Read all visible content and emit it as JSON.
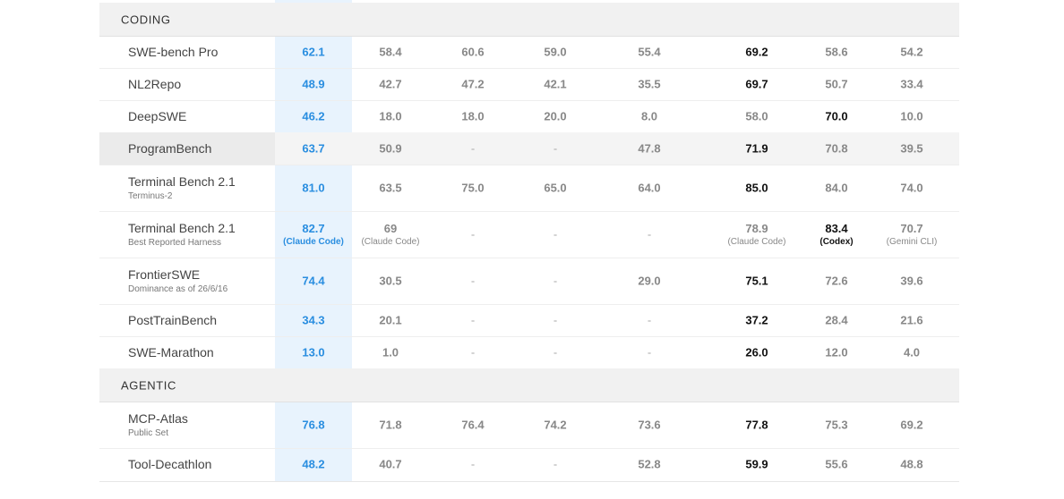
{
  "sections": [
    {
      "label": "CODING",
      "rows": [
        {
          "name": "SWE-bench Pro",
          "sub": "",
          "cells": [
            {
              "v": "62.1",
              "n": "",
              "k": "ours"
            },
            {
              "v": "58.4",
              "n": "",
              "k": ""
            },
            {
              "v": "60.6",
              "n": "",
              "k": ""
            },
            {
              "v": "59.0",
              "n": "",
              "k": ""
            },
            {
              "v": "55.4",
              "n": "",
              "k": ""
            },
            {
              "v": "69.2",
              "n": "",
              "k": "best"
            },
            {
              "v": "58.6",
              "n": "",
              "k": ""
            },
            {
              "v": "54.2",
              "n": "",
              "k": ""
            }
          ]
        },
        {
          "name": "NL2Repo",
          "sub": "",
          "cells": [
            {
              "v": "48.9",
              "n": "",
              "k": "ours"
            },
            {
              "v": "42.7",
              "n": "",
              "k": ""
            },
            {
              "v": "47.2",
              "n": "",
              "k": ""
            },
            {
              "v": "42.1",
              "n": "",
              "k": ""
            },
            {
              "v": "35.5",
              "n": "",
              "k": ""
            },
            {
              "v": "69.7",
              "n": "",
              "k": "best"
            },
            {
              "v": "50.7",
              "n": "",
              "k": ""
            },
            {
              "v": "33.4",
              "n": "",
              "k": ""
            }
          ]
        },
        {
          "name": "DeepSWE",
          "sub": "",
          "cells": [
            {
              "v": "46.2",
              "n": "",
              "k": "ours"
            },
            {
              "v": "18.0",
              "n": "",
              "k": ""
            },
            {
              "v": "18.0",
              "n": "",
              "k": ""
            },
            {
              "v": "20.0",
              "n": "",
              "k": ""
            },
            {
              "v": "8.0",
              "n": "",
              "k": ""
            },
            {
              "v": "58.0",
              "n": "",
              "k": ""
            },
            {
              "v": "70.0",
              "n": "",
              "k": "best"
            },
            {
              "v": "10.0",
              "n": "",
              "k": ""
            }
          ]
        },
        {
          "name": "ProgramBench",
          "sub": "",
          "hover": true,
          "cells": [
            {
              "v": "63.7",
              "n": "",
              "k": "ours"
            },
            {
              "v": "50.9",
              "n": "",
              "k": ""
            },
            {
              "v": "-",
              "n": "",
              "k": "dash"
            },
            {
              "v": "-",
              "n": "",
              "k": "dash"
            },
            {
              "v": "47.8",
              "n": "",
              "k": ""
            },
            {
              "v": "71.9",
              "n": "",
              "k": "best"
            },
            {
              "v": "70.8",
              "n": "",
              "k": ""
            },
            {
              "v": "39.5",
              "n": "",
              "k": ""
            }
          ]
        },
        {
          "name": "Terminal Bench 2.1",
          "sub": "Terminus-2",
          "cells": [
            {
              "v": "81.0",
              "n": "",
              "k": "ours"
            },
            {
              "v": "63.5",
              "n": "",
              "k": ""
            },
            {
              "v": "75.0",
              "n": "",
              "k": ""
            },
            {
              "v": "65.0",
              "n": "",
              "k": ""
            },
            {
              "v": "64.0",
              "n": "",
              "k": ""
            },
            {
              "v": "85.0",
              "n": "",
              "k": "best"
            },
            {
              "v": "84.0",
              "n": "",
              "k": ""
            },
            {
              "v": "74.0",
              "n": "",
              "k": ""
            }
          ]
        },
        {
          "name": "Terminal Bench 2.1",
          "sub": "Best Reported Harness",
          "cells": [
            {
              "v": "82.7",
              "n": "(Claude Code)",
              "k": "ours"
            },
            {
              "v": "69",
              "n": "(Claude Code)",
              "k": ""
            },
            {
              "v": "-",
              "n": "",
              "k": "dash"
            },
            {
              "v": "-",
              "n": "",
              "k": "dash"
            },
            {
              "v": "-",
              "n": "",
              "k": "dash"
            },
            {
              "v": "78.9",
              "n": "(Claude Code)",
              "k": ""
            },
            {
              "v": "83.4",
              "n": "(Codex)",
              "k": "best"
            },
            {
              "v": "70.7",
              "n": "(Gemini CLI)",
              "k": ""
            }
          ]
        },
        {
          "name": "FrontierSWE",
          "sub": "Dominance as of 26/6/16",
          "cells": [
            {
              "v": "74.4",
              "n": "",
              "k": "ours"
            },
            {
              "v": "30.5",
              "n": "",
              "k": ""
            },
            {
              "v": "-",
              "n": "",
              "k": "dash"
            },
            {
              "v": "-",
              "n": "",
              "k": "dash"
            },
            {
              "v": "29.0",
              "n": "",
              "k": ""
            },
            {
              "v": "75.1",
              "n": "",
              "k": "best"
            },
            {
              "v": "72.6",
              "n": "",
              "k": ""
            },
            {
              "v": "39.6",
              "n": "",
              "k": ""
            }
          ]
        },
        {
          "name": "PostTrainBench",
          "sub": "",
          "cells": [
            {
              "v": "34.3",
              "n": "",
              "k": "ours"
            },
            {
              "v": "20.1",
              "n": "",
              "k": ""
            },
            {
              "v": "-",
              "n": "",
              "k": "dash"
            },
            {
              "v": "-",
              "n": "",
              "k": "dash"
            },
            {
              "v": "-",
              "n": "",
              "k": "dash"
            },
            {
              "v": "37.2",
              "n": "",
              "k": "best"
            },
            {
              "v": "28.4",
              "n": "",
              "k": ""
            },
            {
              "v": "21.6",
              "n": "",
              "k": ""
            }
          ]
        },
        {
          "name": "SWE-Marathon",
          "sub": "",
          "cells": [
            {
              "v": "13.0",
              "n": "",
              "k": "ours"
            },
            {
              "v": "1.0",
              "n": "",
              "k": ""
            },
            {
              "v": "-",
              "n": "",
              "k": "dash"
            },
            {
              "v": "-",
              "n": "",
              "k": "dash"
            },
            {
              "v": "-",
              "n": "",
              "k": "dash"
            },
            {
              "v": "26.0",
              "n": "",
              "k": "best"
            },
            {
              "v": "12.0",
              "n": "",
              "k": ""
            },
            {
              "v": "4.0",
              "n": "",
              "k": ""
            }
          ]
        }
      ]
    },
    {
      "label": "AGENTIC",
      "rows": [
        {
          "name": "MCP-Atlas",
          "sub": "Public Set",
          "cells": [
            {
              "v": "76.8",
              "n": "",
              "k": "ours"
            },
            {
              "v": "71.8",
              "n": "",
              "k": ""
            },
            {
              "v": "76.4",
              "n": "",
              "k": ""
            },
            {
              "v": "74.2",
              "n": "",
              "k": ""
            },
            {
              "v": "73.6",
              "n": "",
              "k": ""
            },
            {
              "v": "77.8",
              "n": "",
              "k": "best"
            },
            {
              "v": "75.3",
              "n": "",
              "k": ""
            },
            {
              "v": "69.2",
              "n": "",
              "k": ""
            }
          ]
        },
        {
          "name": "Tool-Decathlon",
          "sub": "",
          "cells": [
            {
              "v": "48.2",
              "n": "",
              "k": "ours"
            },
            {
              "v": "40.7",
              "n": "",
              "k": ""
            },
            {
              "v": "-",
              "n": "",
              "k": "dash"
            },
            {
              "v": "-",
              "n": "",
              "k": "dash"
            },
            {
              "v": "52.8",
              "n": "",
              "k": ""
            },
            {
              "v": "59.9",
              "n": "",
              "k": "best"
            },
            {
              "v": "55.6",
              "n": "",
              "k": ""
            },
            {
              "v": "48.8",
              "n": "",
              "k": ""
            }
          ]
        }
      ]
    }
  ]
}
